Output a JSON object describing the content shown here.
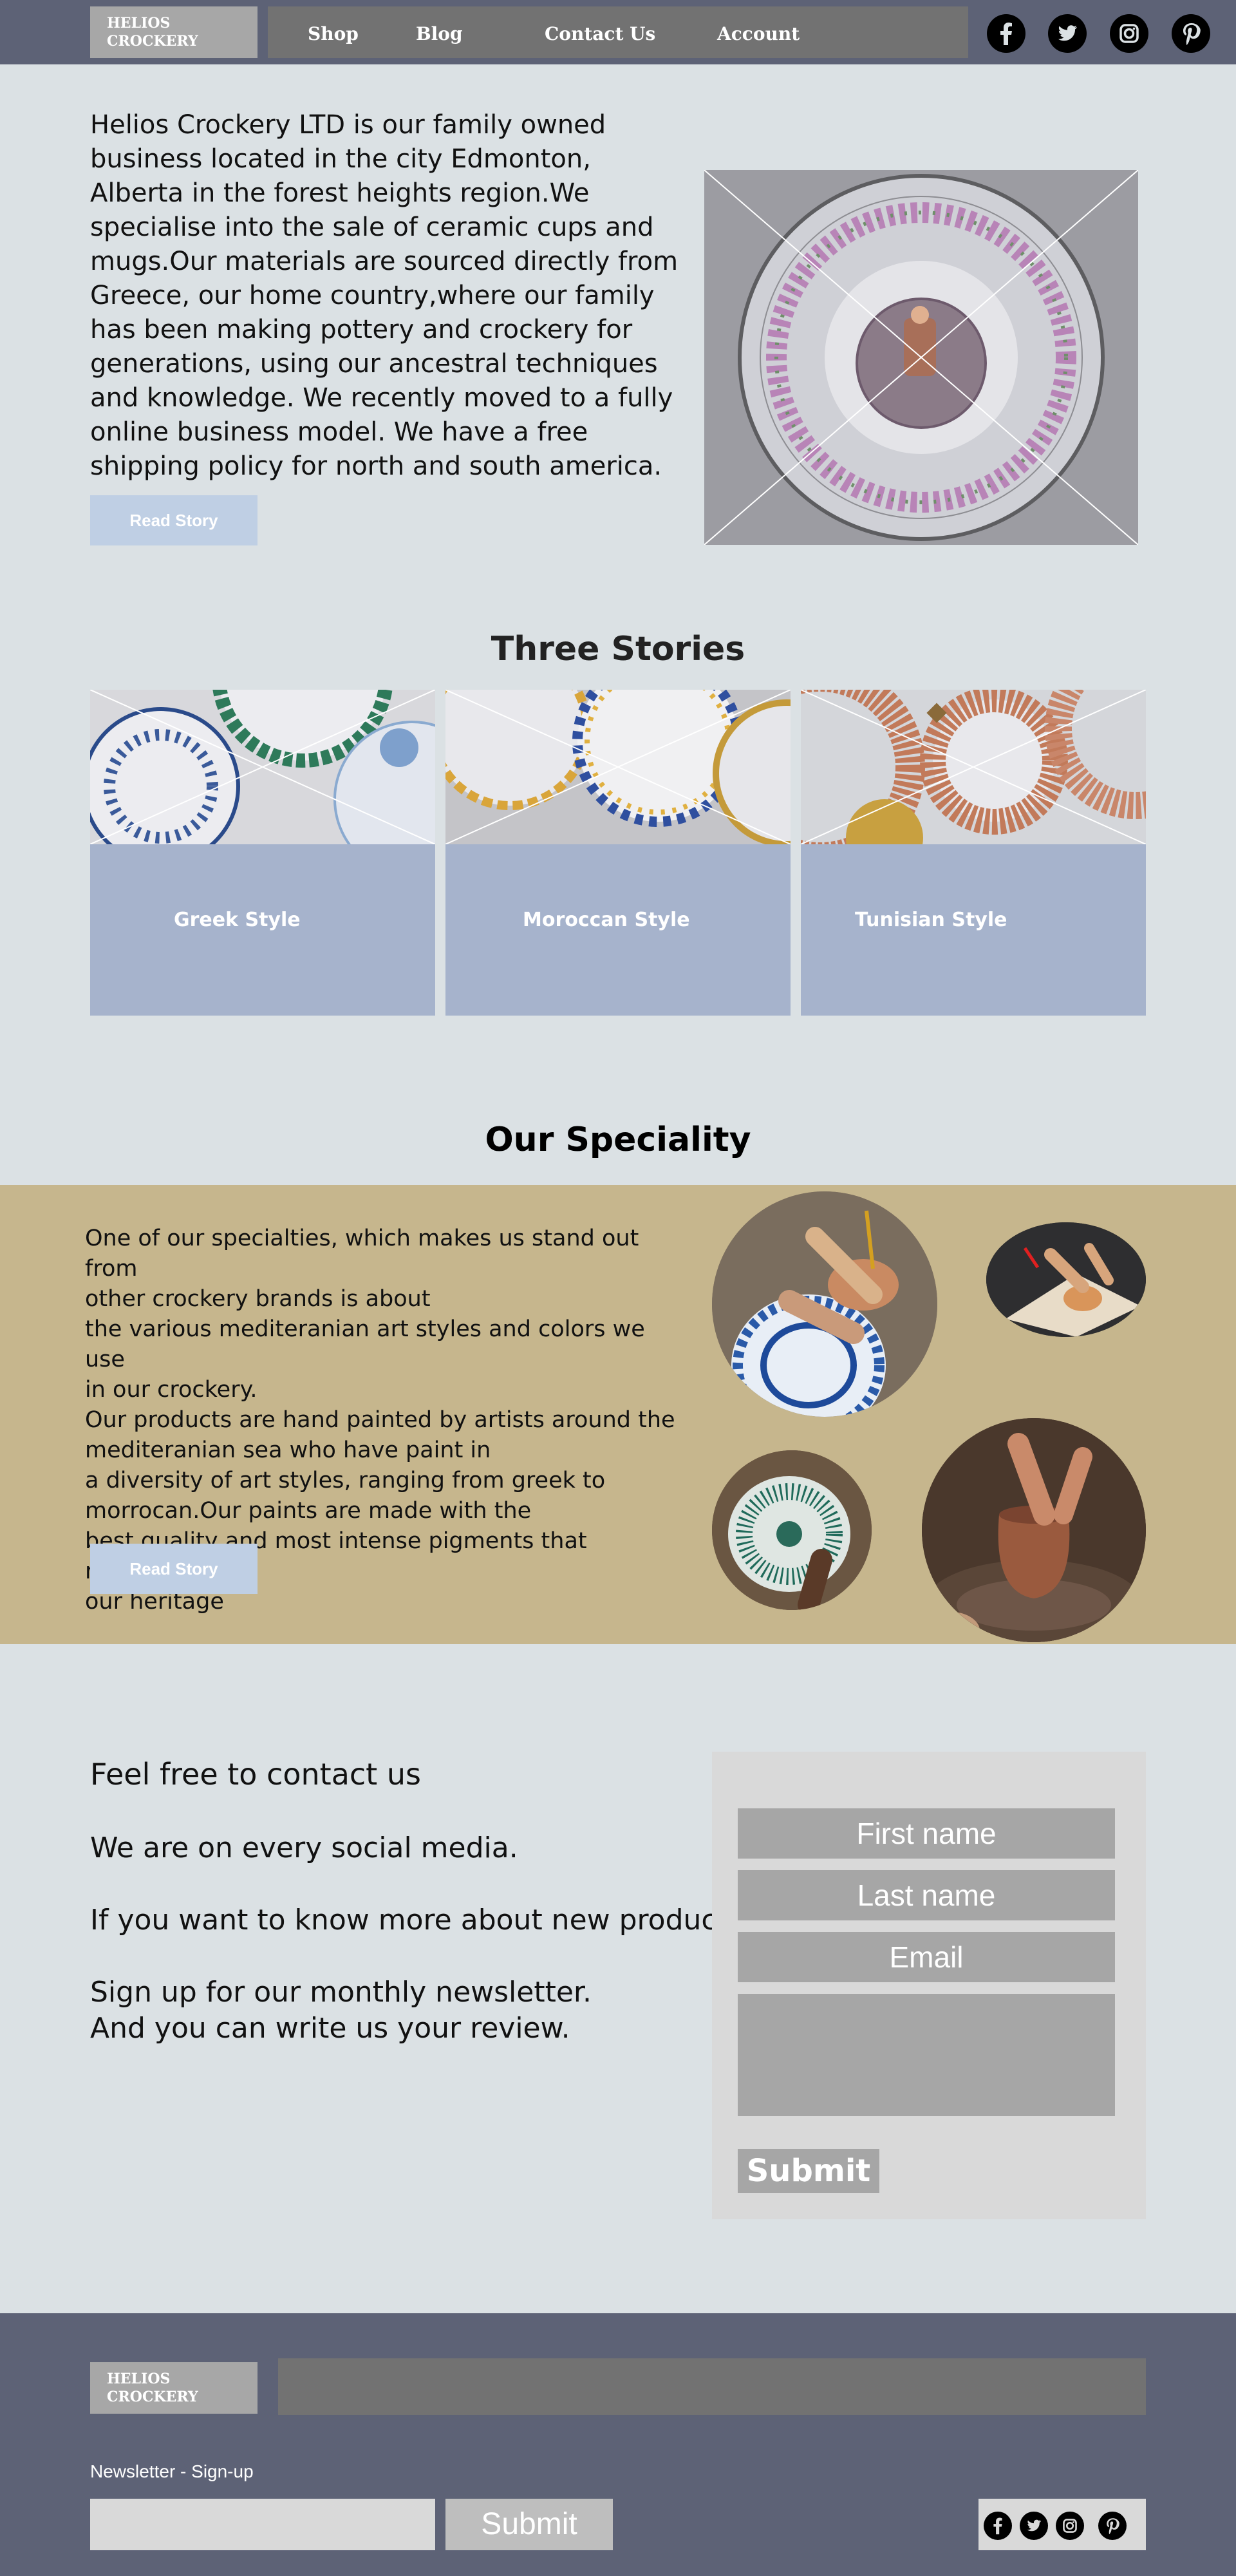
{
  "header": {
    "logo_line1": "HELIOS",
    "logo_line2": "CROCKERY",
    "nav": [
      "Shop",
      "Blog",
      "Contact Us",
      "Account"
    ],
    "social_icons": [
      "facebook-icon",
      "twitter-icon",
      "instagram-icon",
      "pinterest-icon"
    ]
  },
  "intro": {
    "text": "Helios Crockery LTD is our family owned business located in the city Edmonton, Alberta in the forest heights region.We specialise into the sale of ceramic cups and mugs.Our materials are sourced directly from Greece, our home country,where our family has been making pottery and crockery for generations, using our ancestral techniques and knowledge. We recently moved to a fully online business model. We have a free shipping policy for north and south america.",
    "button": "Read Story"
  },
  "stories": {
    "title": "Three Stories",
    "cards": [
      {
        "label": "Greek Style"
      },
      {
        "label": "Moroccan Style"
      },
      {
        "label": "Tunisian Style"
      }
    ]
  },
  "speciality": {
    "title": "Our Speciality",
    "lines": [
      "One of our specialties, which makes us stand out from",
      "other crockery brands is about",
      "the various mediteranian art styles and colors we use",
      "in our crockery.",
      "Our products are hand painted by artists around the",
      "mediteranian sea who have paint in",
      "a diversity of art styles, ranging from greek to",
      "morrocan.Our paints are made with the",
      "best quality and most intense pigments that represent",
      "our heritage"
    ],
    "button": "Read Story"
  },
  "contact": {
    "heading": "Feel free to contact us",
    "line1": "We are on every social media.",
    "line2": "If you want to know more about new products",
    "line3": "Sign up for our monthly newsletter.",
    "line4": "And you can write us your review.",
    "form": {
      "first_name": "First name",
      "last_name": "Last name",
      "email": "Email",
      "submit": "Submit"
    }
  },
  "footer": {
    "logo_line1": "HELIOS",
    "logo_line2": "CROCKERY",
    "newsletter_label": "Newsletter - Sign-up",
    "submit": "Submit"
  },
  "colors": {
    "header_bg": "#5d6276",
    "page_bg": "#dbe1e4",
    "card_bg": "#a6b3cc",
    "speciality_band": "#c6b68d",
    "button_light": "#bfcfe4"
  }
}
